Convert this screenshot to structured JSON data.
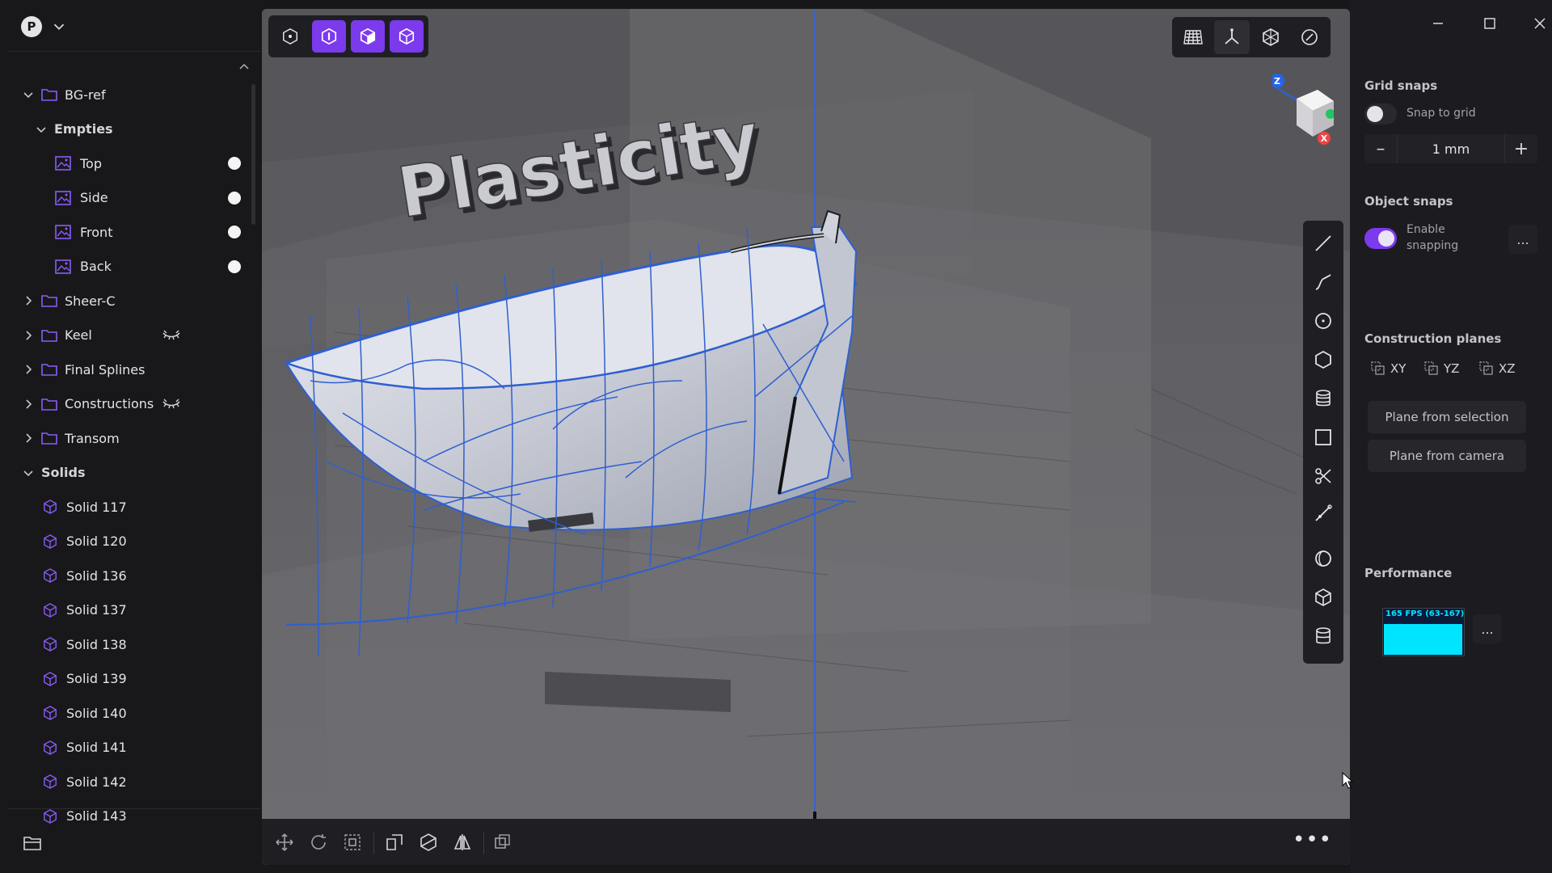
{
  "user": {
    "avatar_letter": "P"
  },
  "outliner": {
    "rows": [
      {
        "level": 0,
        "type": "folder",
        "label": "BG-ref",
        "expanded": true
      },
      {
        "level": 1,
        "type": "group",
        "label": "Empties",
        "expanded": true
      },
      {
        "level": 2,
        "type": "empty",
        "label": "Top",
        "visible": true
      },
      {
        "level": 2,
        "type": "empty",
        "label": "Side",
        "visible": true
      },
      {
        "level": 2,
        "type": "empty",
        "label": "Front",
        "visible": true
      },
      {
        "level": 2,
        "type": "empty",
        "label": "Back",
        "visible": true
      },
      {
        "level": 0,
        "type": "folder",
        "label": "Sheer-C",
        "expanded": false
      },
      {
        "level": 0,
        "type": "folder",
        "label": "Keel",
        "expanded": false,
        "hidden": true
      },
      {
        "level": 0,
        "type": "folder",
        "label": "Final Splines",
        "expanded": false
      },
      {
        "level": 0,
        "type": "folder",
        "label": "Constructions",
        "expanded": false,
        "hidden": true
      },
      {
        "level": 0,
        "type": "folder",
        "label": "Transom",
        "expanded": false
      },
      {
        "level": 0,
        "type": "group",
        "label": "Solids",
        "expanded": true
      },
      {
        "level": 1,
        "type": "solid",
        "label": "Solid 117"
      },
      {
        "level": 1,
        "type": "solid",
        "label": "Solid 120"
      },
      {
        "level": 1,
        "type": "solid",
        "label": "Solid 136"
      },
      {
        "level": 1,
        "type": "solid",
        "label": "Solid 137"
      },
      {
        "level": 1,
        "type": "solid",
        "label": "Solid 138"
      },
      {
        "level": 1,
        "type": "solid",
        "label": "Solid 139"
      },
      {
        "level": 1,
        "type": "solid",
        "label": "Solid 140"
      },
      {
        "level": 1,
        "type": "solid",
        "label": "Solid 141"
      },
      {
        "level": 1,
        "type": "solid",
        "label": "Solid 142"
      },
      {
        "level": 1,
        "type": "solid",
        "label": "Solid 143"
      }
    ]
  },
  "viewport": {
    "scene_text": "Plasticity",
    "navcube_axes": {
      "z": "Z",
      "x": "X"
    },
    "selection_modes": [
      {
        "name": "control-point-mode",
        "active": false
      },
      {
        "name": "edge-mode",
        "active": true
      },
      {
        "name": "face-mode",
        "active": true
      },
      {
        "name": "solid-mode",
        "active": true
      }
    ]
  },
  "right_panel": {
    "grid_snaps": {
      "title": "Grid snaps",
      "snap_label": "Snap to grid",
      "snap_on": false,
      "step_value": "1 mm",
      "minus": "–",
      "plus": "+"
    },
    "object_snaps": {
      "title": "Object snaps",
      "enable_label": "Enable snapping",
      "enabled": true,
      "more": "..."
    },
    "construction_planes": {
      "title": "Construction planes",
      "planes": [
        "XY",
        "YZ",
        "XZ"
      ],
      "from_selection": "Plane from selection",
      "from_camera": "Plane from camera"
    },
    "performance": {
      "title": "Performance",
      "fps_text": "165 FPS (63-167)",
      "fps_fraction": 0.99,
      "more": "..."
    }
  },
  "colors": {
    "accent": "#7c3aed",
    "wire": "#2f5fd0",
    "fps": "#00e5ff"
  }
}
